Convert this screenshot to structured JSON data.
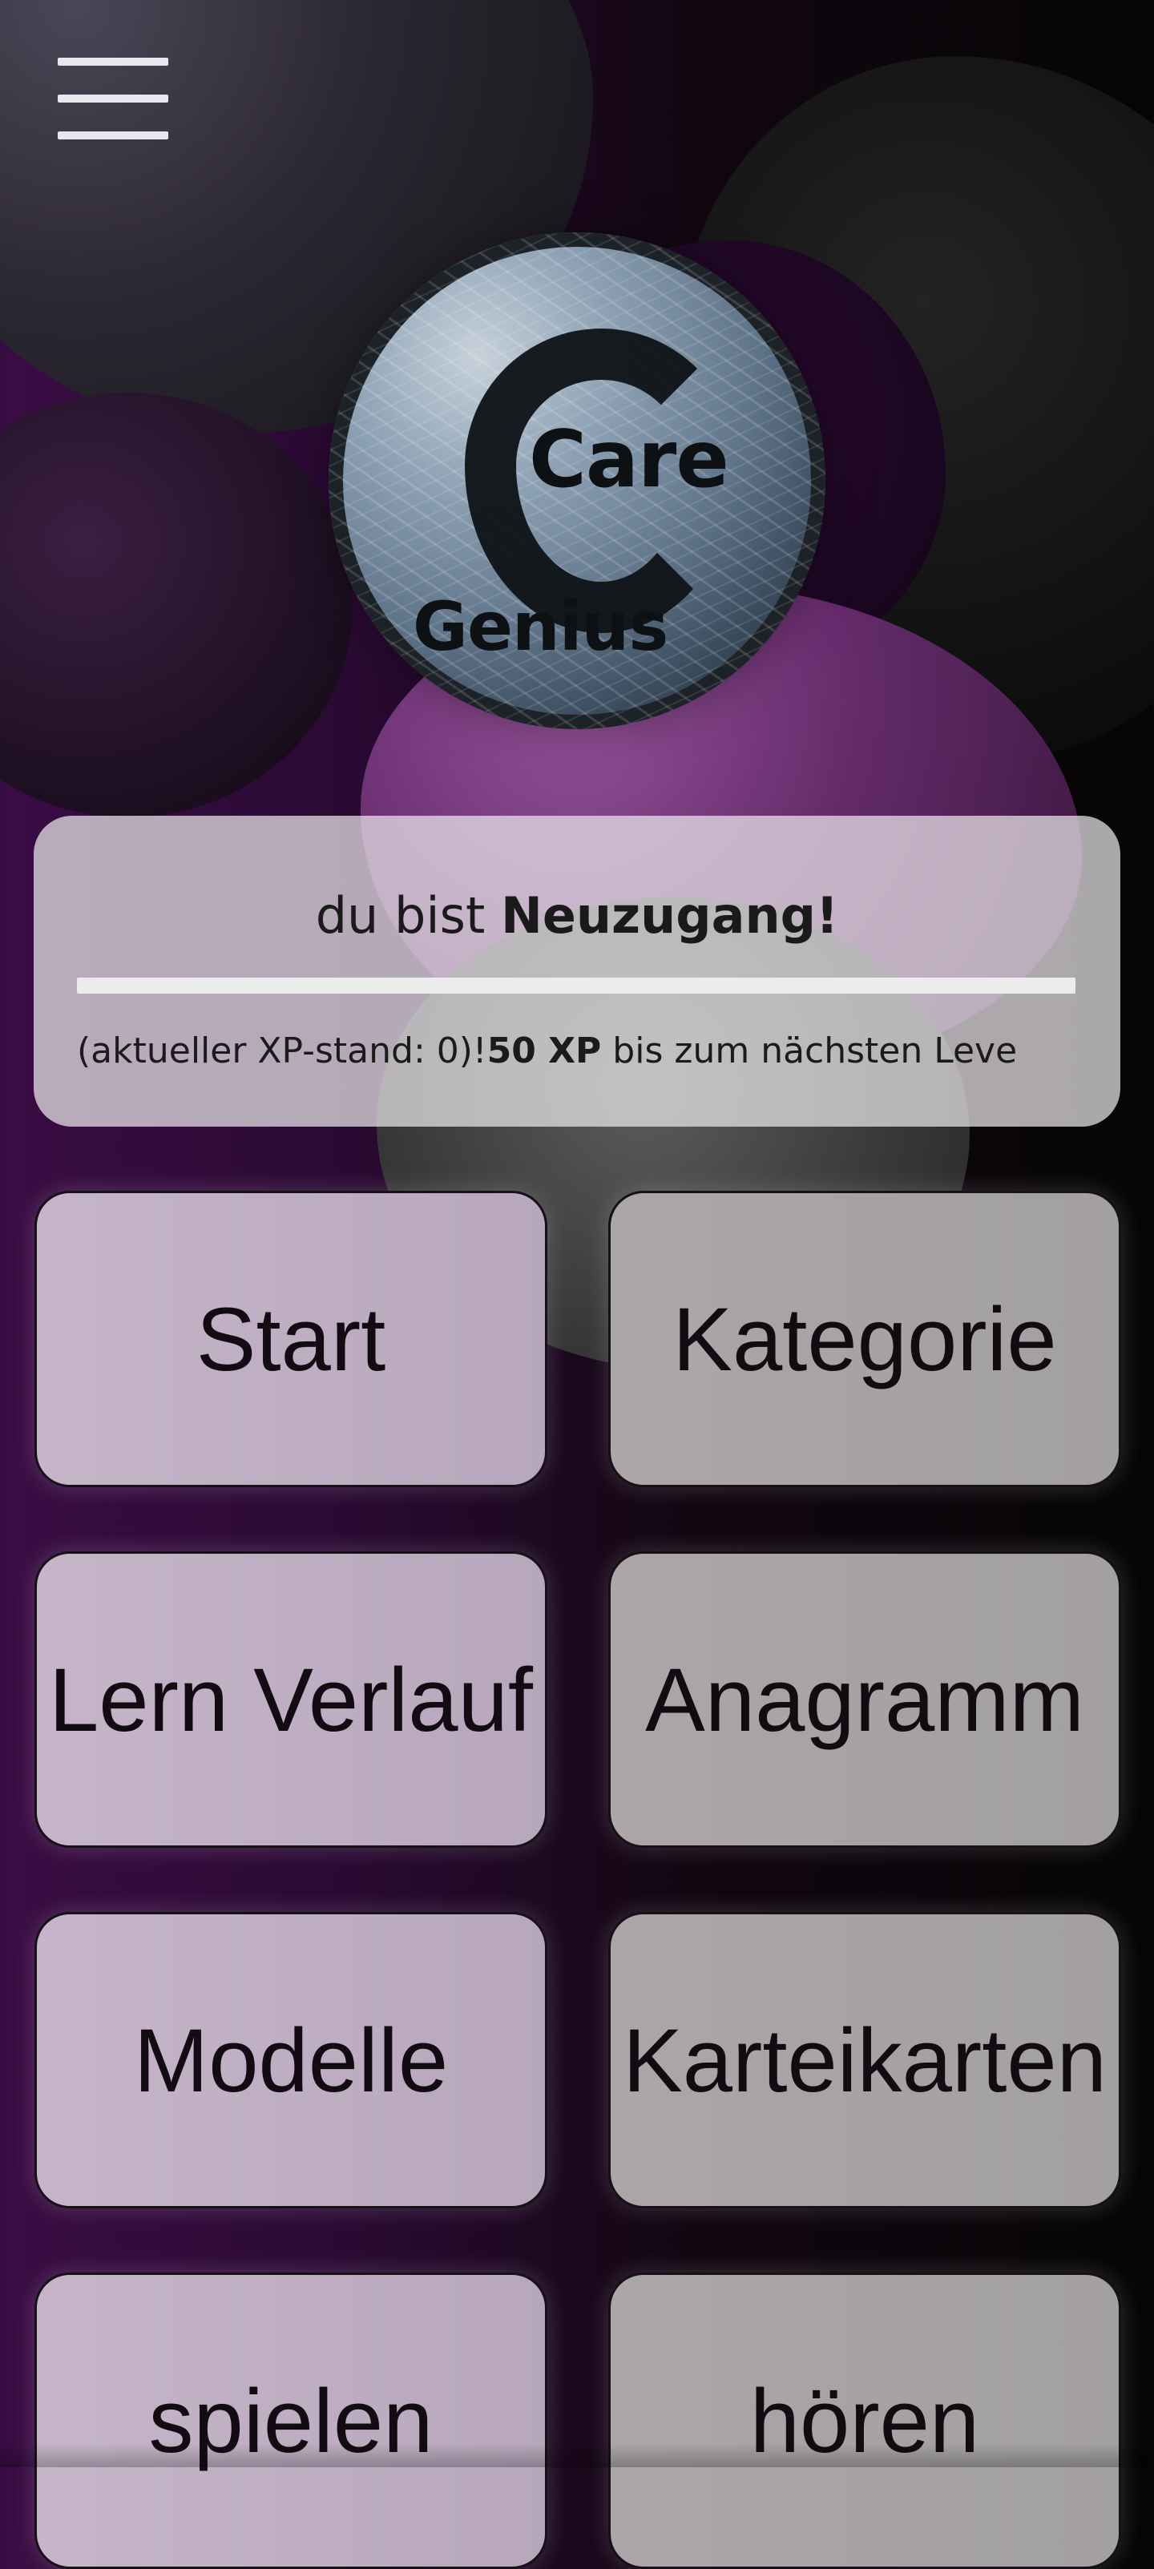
{
  "header": {
    "menu_icon": "hamburger-menu-icon"
  },
  "logo": {
    "care_text": "Care",
    "genius_text": "Genius"
  },
  "xp_card": {
    "status_prefix": "du bist ",
    "status_level": "Neuzugang!",
    "progress_fraction": 0,
    "xp_text_prefix": "(aktueller XP-stand: 0)!",
    "xp_needed": "50 XP",
    "xp_text_suffix": " bis zum nächsten Leve"
  },
  "menu_tiles": [
    {
      "label": "Start"
    },
    {
      "label": "Kategorie"
    },
    {
      "label": "Lern Verlauf"
    },
    {
      "label": "Anagramm"
    },
    {
      "label": "Modelle"
    },
    {
      "label": "Karteikarten"
    },
    {
      "label": "spielen"
    },
    {
      "label": "hören"
    }
  ],
  "colors": {
    "background_left": "#3a0c44",
    "background_right": "#050505",
    "card_bg": "#ece8ec",
    "tile_left_bg": "#c6b5c9",
    "tile_right_bg": "#aba6a8"
  }
}
